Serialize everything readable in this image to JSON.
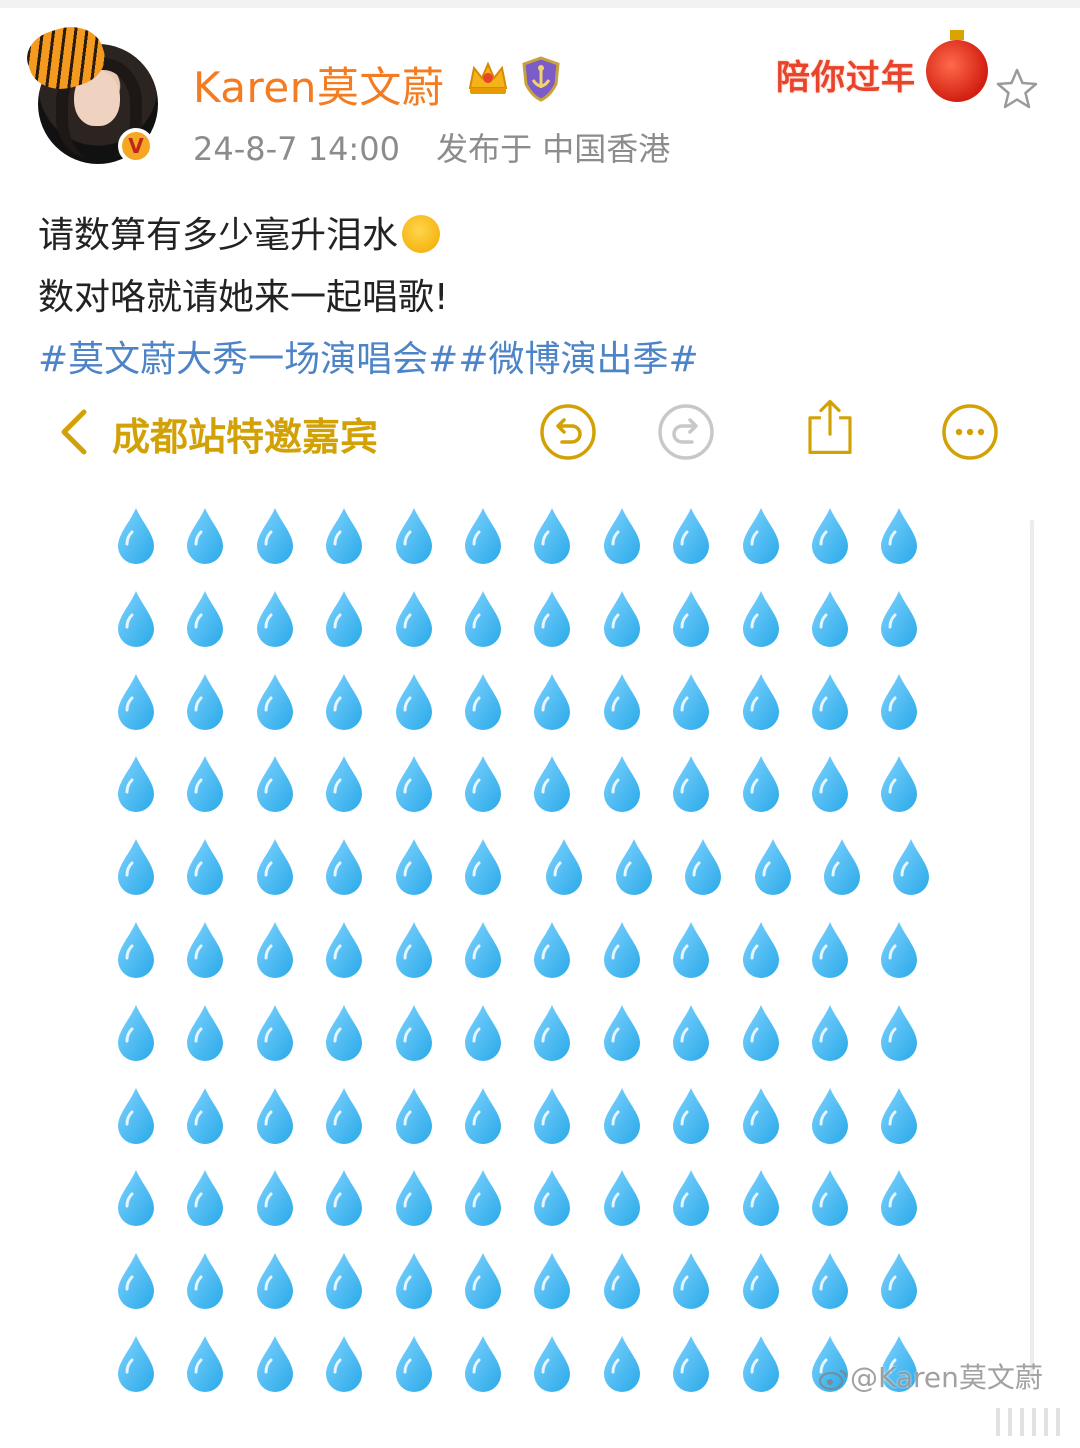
{
  "post": {
    "username": "Karen莫文蔚",
    "timestamp": "24-8-7 14:00",
    "location": "发布于 中国香港",
    "verified_badge": "V",
    "promo_label": "陪你过年",
    "lines": [
      "请数算有多少毫升泪水",
      "数对咯就请她来一起唱歌!"
    ],
    "hashtags": "#莫文蔚大秀一场演唱会##微博演出季#"
  },
  "toolbar": {
    "title": "成都站特邀嘉宾",
    "buttons": [
      "back-icon",
      "undo-icon",
      "redo-icon",
      "share-icon",
      "more-icon"
    ]
  },
  "drops": {
    "icon": "water-drop-icon",
    "rows": 11,
    "columns": 12,
    "color": "#2aa9e8"
  },
  "watermark": {
    "text": "@Karen莫文蔚"
  },
  "colors": {
    "username": "#f47b20",
    "hashtag": "#4d83c7",
    "toolbar_accent": "#d2a106",
    "meta": "#8c8c8c"
  }
}
